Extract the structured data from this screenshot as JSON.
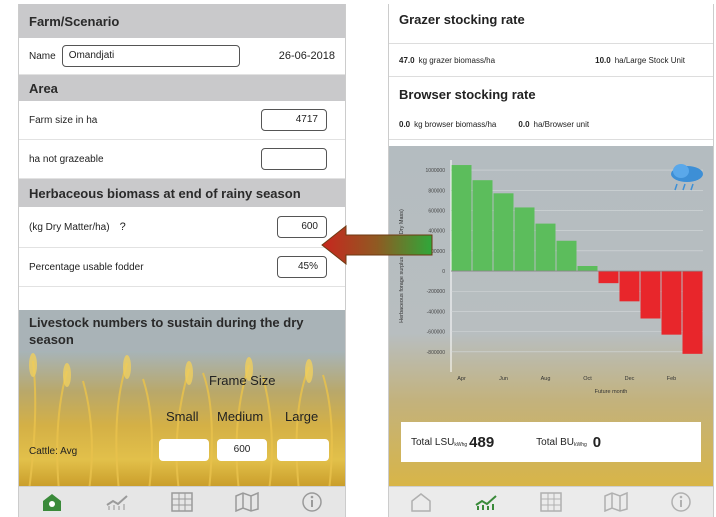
{
  "left": {
    "farm_header": "Farm/Scenario",
    "name_label": "Name",
    "name_value": "Omandjati",
    "date": "26-06-2018",
    "area_header": "Area",
    "farm_size_label": "Farm size in ha",
    "farm_size_value": "4717",
    "not_grazeable_label": "ha not grazeable",
    "not_grazeable_value": "",
    "biomass_header": "Herbaceous biomass at end of rainy season",
    "dm_label": "(kg Dry Matter/ha)",
    "help_mark": "?",
    "dm_value": "600",
    "usable_label": "Percentage usable fodder",
    "usable_value": "45%",
    "livestock_header": "Livestock numbers to sustain during the dry season",
    "frame_size_label": "Frame Size",
    "size_small": "Small",
    "size_medium": "Medium",
    "size_large": "Large",
    "cattle_label": "Cattle: Avg",
    "cattle_small": "",
    "cattle_medium": "600",
    "cattle_large": ""
  },
  "right": {
    "grazer_header": "Grazer stocking rate",
    "grazer_biomass_value": "47.0",
    "grazer_biomass_unit": "kg grazer biomass/ha",
    "grazer_ha_value": "10.0",
    "grazer_ha_unit": "ha/Large Stock Unit",
    "browser_header": "Browser stocking rate",
    "browser_biomass_value": "0.0",
    "browser_biomass_unit": "kg browser biomass/ha",
    "browser_ha_value": "0.0",
    "browser_ha_unit": "ha/Browser unit",
    "total_lsu_label": "Total LSU",
    "total_lsu_sub": "kWhg",
    "total_lsu_value": "489",
    "total_bu_label": "Total BU",
    "total_bu_sub": "kWhg",
    "total_bu_value": "0"
  },
  "tabs": [
    "home-icon",
    "chart-icon",
    "grid-icon",
    "map-icon",
    "info-icon"
  ],
  "colors": {
    "positive": "#5cbd5c",
    "negative": "#e8262b",
    "arrow_red": "#c8261e",
    "arrow_green": "#2fa83a"
  },
  "chart_data": {
    "type": "bar",
    "ylabel": "Herbaceous forage surplus in ... (kg Dry Mass)",
    "xlabel": "Future month",
    "ylim": [
      -1000000,
      1100000
    ],
    "y_ticks": [
      1000000,
      800000,
      600000,
      400000,
      200000,
      0,
      -200000,
      -400000,
      -600000,
      -800000
    ],
    "y_tick_labels": [
      "1000000",
      "800000",
      "600000",
      "400000",
      "200000",
      "0",
      "-200000",
      "-400000",
      "-600000",
      "-800000"
    ],
    "categories": [
      "Apr",
      "May",
      "Jun",
      "Jul",
      "Aug",
      "Sep",
      "Oct",
      "Nov",
      "Dec",
      "Jan",
      "Feb",
      "Mar"
    ],
    "x_tick_labels": [
      "Apr",
      "Jun",
      "Aug",
      "Oct",
      "Dec",
      "Feb"
    ],
    "values": [
      1050000,
      900000,
      770000,
      630000,
      470000,
      300000,
      50000,
      -120000,
      -300000,
      -470000,
      -630000,
      -820000
    ]
  }
}
